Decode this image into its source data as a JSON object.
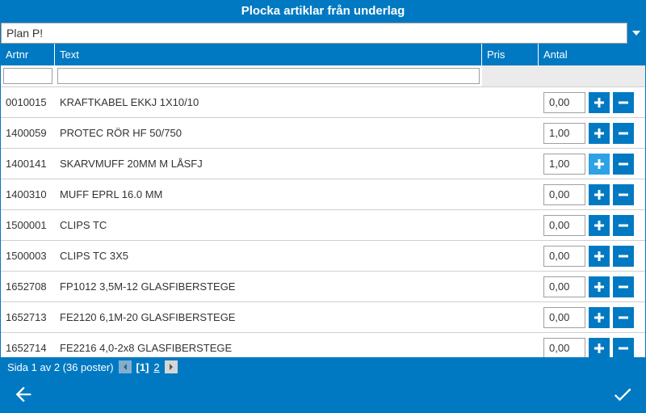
{
  "title": "Plocka artiklar från underlag",
  "dropdown": {
    "value": "Plan P!"
  },
  "columns": {
    "artnr": "Artnr",
    "text": "Text",
    "pris": "Pris",
    "antal": "Antal"
  },
  "filters": {
    "artnr": "",
    "text": ""
  },
  "rows": [
    {
      "artnr": "0010015",
      "text": "KRAFTKABEL EKKJ 1X10/10",
      "pris": "",
      "antal": "0,00",
      "hover": false
    },
    {
      "artnr": "1400059",
      "text": "PROTEC RÖR HF 50/750",
      "pris": "",
      "antal": "1,00",
      "hover": false
    },
    {
      "artnr": "1400141",
      "text": "SKARVMUFF 20MM M LÅSFJ",
      "pris": "",
      "antal": "1,00",
      "hover": true
    },
    {
      "artnr": "1400310",
      "text": "MUFF EPRL 16.0 MM",
      "pris": "",
      "antal": "0,00",
      "hover": false
    },
    {
      "artnr": "1500001",
      "text": "CLIPS TC",
      "pris": "",
      "antal": "0,00",
      "hover": false
    },
    {
      "artnr": "1500003",
      "text": "CLIPS TC 3X5",
      "pris": "",
      "antal": "0,00",
      "hover": false
    },
    {
      "artnr": "1652708",
      "text": "FP1012 3,5M-12 GLASFIBERSTEGE",
      "pris": "",
      "antal": "0,00",
      "hover": false
    },
    {
      "artnr": "1652713",
      "text": "FE2120 6,1M-20 GLASFIBERSTEGE",
      "pris": "",
      "antal": "0,00",
      "hover": false
    },
    {
      "artnr": "1652714",
      "text": "FE2216 4,0-2x8 GLASFIBERSTEGE",
      "pris": "",
      "antal": "0,00",
      "hover": false
    }
  ],
  "pager": {
    "summary": "Sida 1 av 2 (36 poster)",
    "current": "[1]",
    "other": "2"
  }
}
